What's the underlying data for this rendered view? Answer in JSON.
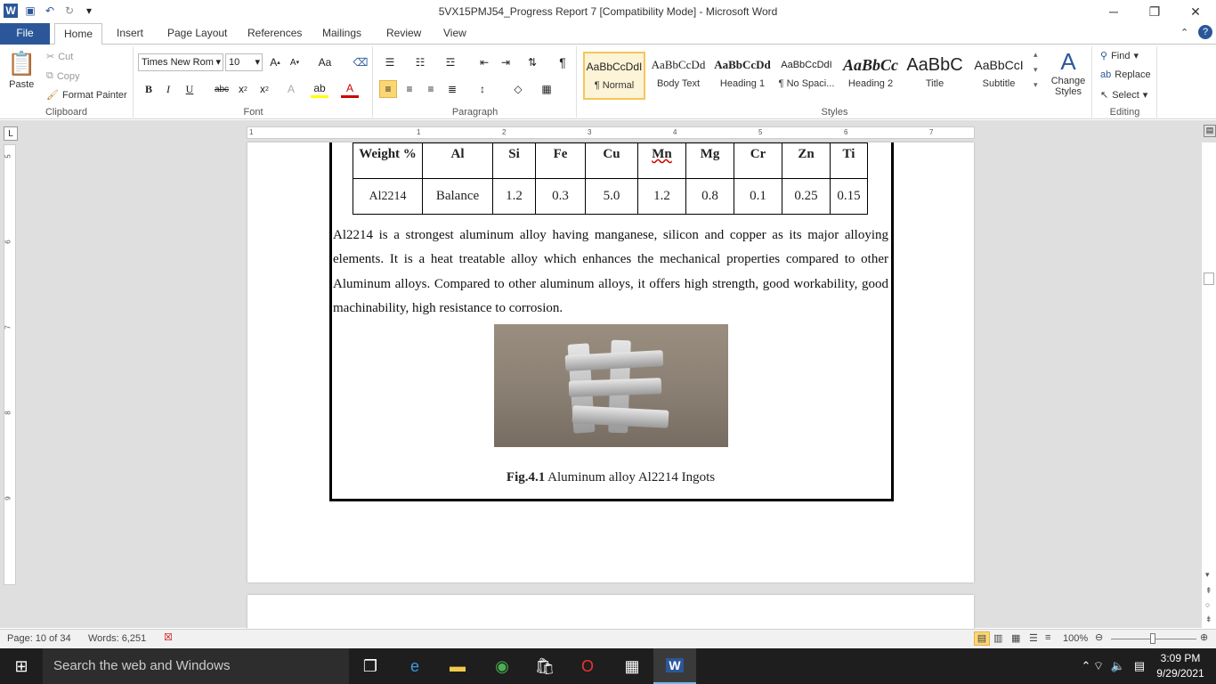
{
  "window": {
    "title": "5VX15PMJ54_Progress Report 7 [Compatibility Mode]  -  Microsoft Word",
    "minimize": "─",
    "restore": "❐",
    "close": "✕"
  },
  "tabs": [
    "File",
    "Home",
    "Insert",
    "Page Layout",
    "References",
    "Mailings",
    "Review",
    "View"
  ],
  "ribbon": {
    "clipboard": {
      "paste": "Paste",
      "cut": "Cut",
      "copy": "Copy",
      "format_painter": "Format Painter",
      "label": "Clipboard"
    },
    "font": {
      "name": "Times New Rom",
      "size": "10",
      "label": "Font"
    },
    "paragraph": {
      "label": "Paragraph"
    },
    "styles": {
      "label": "Styles",
      "items": [
        {
          "preview": "AaBbCcDdI",
          "name": "¶ Normal"
        },
        {
          "preview": "AaBbCcDd",
          "name": "Body Text"
        },
        {
          "preview": "AaBbCcDd",
          "name": "Heading 1"
        },
        {
          "preview": "AaBbCcDdI",
          "name": "¶ No Spaci..."
        },
        {
          "preview": "AaBbCc",
          "name": "Heading 2"
        },
        {
          "preview": "AaBbC",
          "name": "Title"
        },
        {
          "preview": "AaBbCcI",
          "name": "Subtitle"
        }
      ],
      "change_styles": "Change Styles"
    },
    "editing": {
      "find": "Find",
      "replace": "Replace",
      "select": "Select",
      "label": "Editing"
    }
  },
  "ruler": {
    "h_numbers": [
      "1",
      "1",
      "2",
      "3",
      "4",
      "5",
      "6",
      "7"
    ],
    "v_numbers": [
      "5",
      "6",
      "7",
      "8",
      "9"
    ]
  },
  "document": {
    "table": {
      "headers": [
        "Weight %",
        "Al",
        "Si",
        "Fe",
        "Cu",
        "Mn",
        "Mg",
        "Cr",
        "Zn",
        "Ti"
      ],
      "row": [
        "Al2214",
        "Balance",
        "1.2",
        "0.3",
        "5.0",
        "1.2",
        "0.8",
        "0.1",
        "0.25",
        "0.15"
      ]
    },
    "paragraph": "Al2214 is a strongest aluminum alloy having manganese, silicon and copper as its major alloying elements. It is a heat treatable alloy which enhances the mechanical properties compared to other Aluminum alloys. Compared to other aluminum alloys, it offers high strength, good workability, good machinability, high resistance to corrosion.",
    "caption_bold": "Fig.4.1",
    "caption_text": " Aluminum alloy Al2214 Ingots"
  },
  "status": {
    "page": "Page: 10 of 34",
    "words": "Words: 6,251",
    "zoom": "100%"
  },
  "taskbar": {
    "search": "Search the web and Windows",
    "time": "3:09 PM",
    "date": "9/29/2021"
  }
}
